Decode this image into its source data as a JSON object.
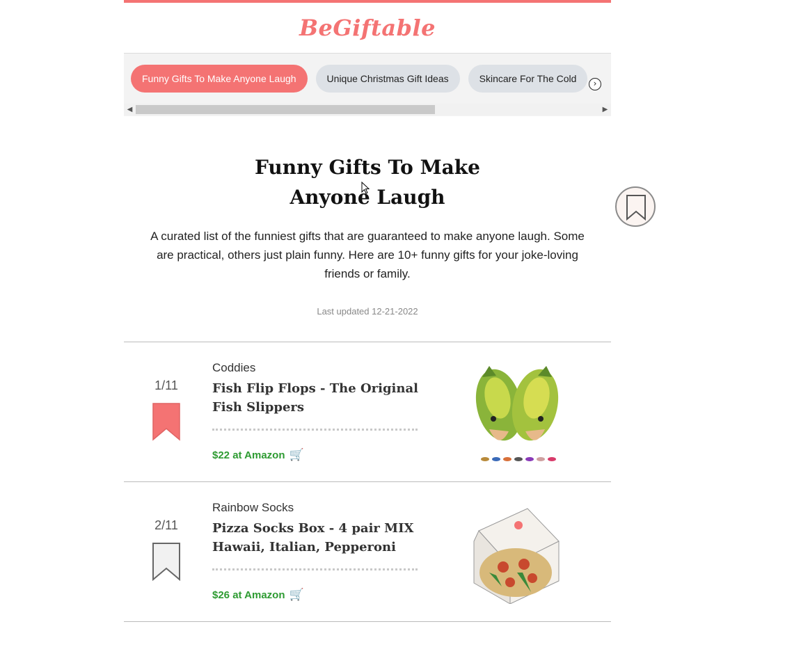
{
  "site": {
    "logo": "BeGiftable"
  },
  "tabs": [
    {
      "label": "Funny Gifts To Make Anyone Laugh",
      "active": true
    },
    {
      "label": "Unique Christmas Gift Ideas",
      "active": false
    },
    {
      "label": "Skincare For The Cold",
      "active": false
    }
  ],
  "hero": {
    "title": "Funny Gifts To Make Anyone Laugh",
    "description": "A curated list of the funniest gifts that are guaranteed to make anyone laugh. Some are practical, others just plain funny. Here are 10+ funny gifts for your joke-loving friends or family.",
    "updated": "Last updated 12-21-2022"
  },
  "items": [
    {
      "rank": "1/11",
      "brand": "Coddies",
      "name": "Fish Flip Flops - The Original Fish Slippers",
      "price": "$22 at Amazon",
      "saved": true
    },
    {
      "rank": "2/11",
      "brand": "Rainbow Socks",
      "name": "Pizza Socks Box - 4 pair MIX Hawaii, Italian, Pepperoni",
      "price": "$26 at Amazon",
      "saved": false
    }
  ],
  "colors": {
    "accent": "#f47373",
    "price": "#2e9b32",
    "tab_inactive": "#dde1e6"
  },
  "icons": {
    "cart": "🛒",
    "next": "›",
    "scroll_left": "◀",
    "scroll_right": "▶"
  }
}
